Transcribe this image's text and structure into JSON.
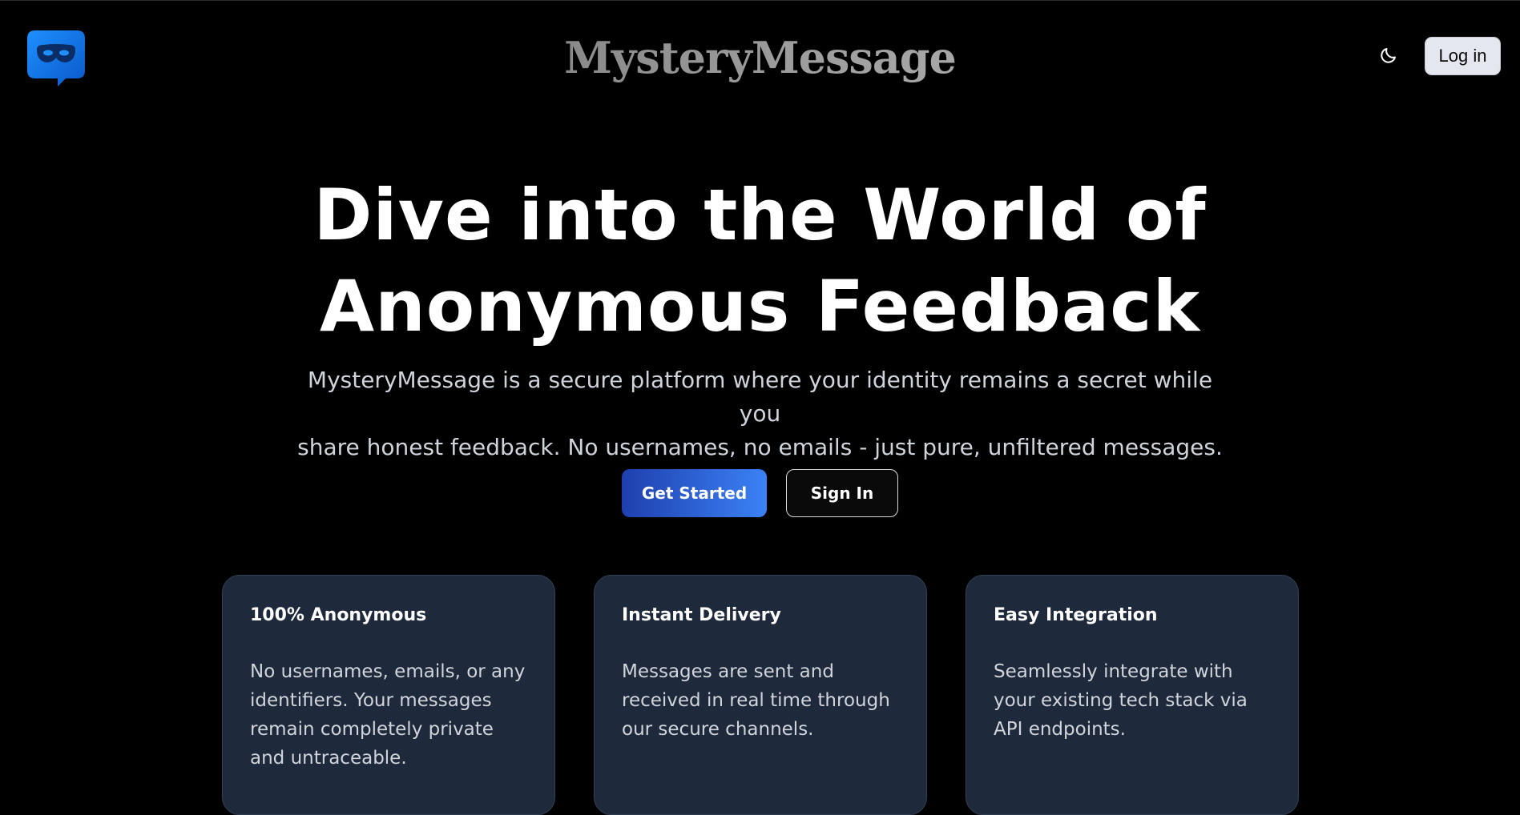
{
  "header": {
    "brand": "MysteryMessage",
    "logo_icon": "masked-chat-bubble-icon",
    "theme_icon": "moon-icon",
    "login_label": "Log in"
  },
  "hero": {
    "title_line1": "Dive into the World of",
    "title_line2": "Anonymous Feedback",
    "subtitle_line1": "MysteryMessage is a secure platform where your identity remains a secret while you",
    "subtitle_line2": "share honest feedback. No usernames, no emails - just pure, unfiltered messages.",
    "primary_cta": "Get Started",
    "secondary_cta": "Sign In"
  },
  "features": [
    {
      "title": "100% Anonymous",
      "text": "No usernames, emails, or any identifiers. Your messages remain completely private and untraceable."
    },
    {
      "title": "Instant Delivery",
      "text": "Messages are sent and received in real time through our secure channels."
    },
    {
      "title": "Easy Integration",
      "text": "Seamlessly integrate with your existing tech stack via API endpoints."
    }
  ],
  "colors": {
    "background": "#000000",
    "card_bg": "#1e293b",
    "accent_start": "#1f3fae",
    "accent_end": "#3b82f6",
    "logo_blue": "#1877f2"
  }
}
